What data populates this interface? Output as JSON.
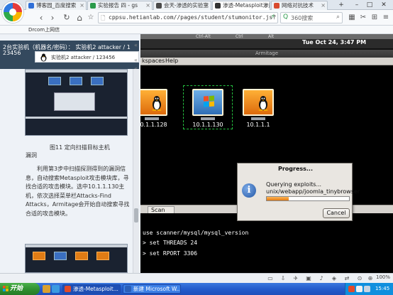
{
  "browser": {
    "tabs": [
      {
        "label": "博客园_百度搜索",
        "color": "#2f6fd8",
        "active": false
      },
      {
        "label": "实验报告 四 - gs",
        "color": "#2a9a4a",
        "active": false
      },
      {
        "label": "会天-渗透的实验室",
        "color": "#4a4a4a",
        "active": false
      },
      {
        "label": "渗透-Metasploit渗透",
        "color": "#333333",
        "active": true
      },
      {
        "label": "网络对抗技术",
        "color": "#d84a2f",
        "active": false
      }
    ],
    "url": "cppsu.hetianlab.com//pages/student/stumonitor.js?",
    "search_placeholder": "360搜索",
    "bookmark": "Drcom上网信"
  },
  "lab": {
    "line1": "2台实验机（机器名/密码）：  实验机2    attacker / 1",
    "line2": "23456",
    "vm_label": "实验机2    attacker / 123456"
  },
  "doc": {
    "caption": "图11 定向扫描目标主机",
    "p1": "漏洞",
    "p2": "利用第3步中扫描探测得到的漏洞信息，自动搜索Metasploit攻击模块库，寻找合适的攻击模块。选中10.1.1.130主机，依次选择菜单栏Attacks-Find Attacks，Armitage会开始自动搜索寻找合适的攻击模块。"
  },
  "remote": {
    "strip_labels": [
      "Ctrl-Alt",
      "Ctrl",
      "Alt"
    ],
    "clock": "Tue Oct 24,  3:47 PM",
    "window_title": "Armitage",
    "menu": {
      "workspaces": "kspaces",
      "help": "Help"
    },
    "hosts": [
      {
        "ip": "10.1.1.128",
        "os": "linux"
      },
      {
        "ip": "10.1.1.130",
        "os": "windows"
      },
      {
        "ip": "10.1.1.1",
        "os": "linux"
      }
    ],
    "tab": "Scan",
    "console": [
      "use scanner/mysql/mysql_version",
      "> set THREADS 24",
      "> set RPORT 3306"
    ]
  },
  "dialog": {
    "title": "Progress...",
    "line1": "Querying exploits...",
    "line2": "unix/webapp/joomla_tinybrowser",
    "progress": 0.27,
    "cancel": "Cancel"
  },
  "status": {
    "zoom": "100%"
  },
  "taskbar": {
    "start": "开始",
    "tasks": [
      {
        "label": "渗透-Metasploit...",
        "color": "#e24a2a",
        "active": true
      },
      {
        "label": "新建 Microsoft W...",
        "color": "#2b5fb8",
        "active": false
      }
    ],
    "time": "15:45"
  }
}
